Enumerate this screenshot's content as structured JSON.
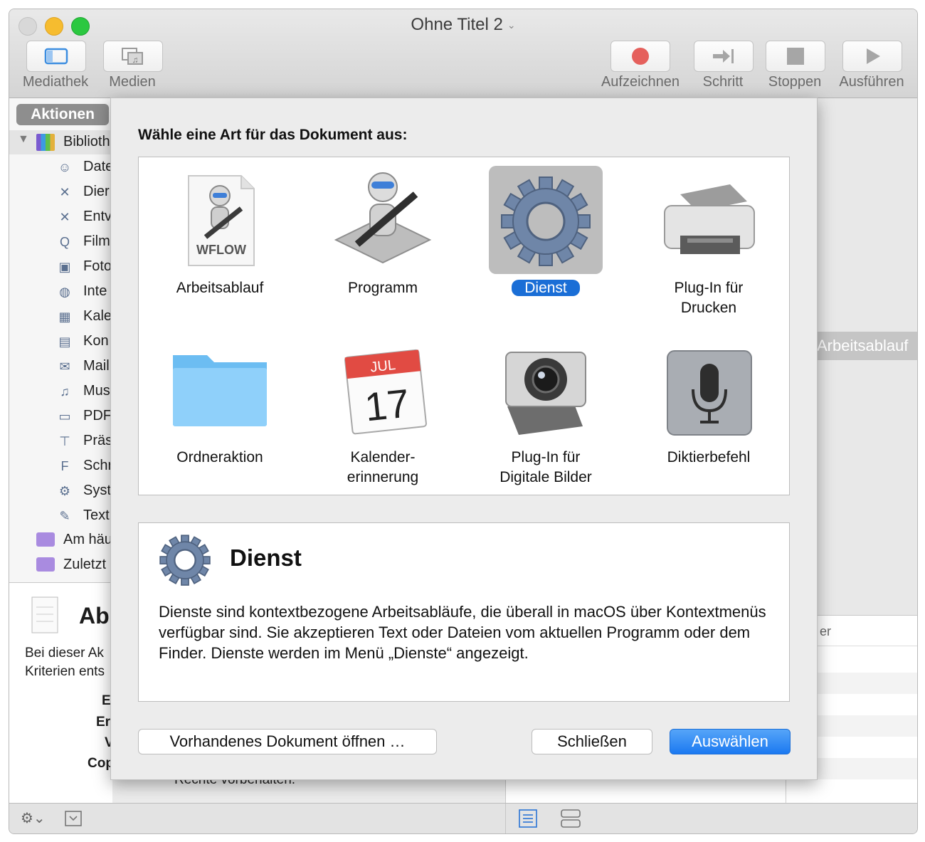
{
  "window": {
    "title": "Ohne Titel 2"
  },
  "toolbar": {
    "library_label": "Mediathek",
    "media_label": "Medien",
    "record_label": "Aufzeichnen",
    "step_label": "Schritt",
    "stop_label": "Stoppen",
    "run_label": "Ausführen"
  },
  "sidebar": {
    "tab_label": "Aktionen",
    "library_root": "Biblioth",
    "items": [
      {
        "label": "Date",
        "icon": "finder-icon"
      },
      {
        "label": "Dier",
        "icon": "tools-icon"
      },
      {
        "label": "Entv",
        "icon": "tools-icon"
      },
      {
        "label": "Film",
        "icon": "quicktime-icon"
      },
      {
        "label": "Foto",
        "icon": "photos-icon"
      },
      {
        "label": "Inte",
        "icon": "globe-icon"
      },
      {
        "label": "Kale",
        "icon": "calendar-icon"
      },
      {
        "label": "Kon",
        "icon": "contacts-icon"
      },
      {
        "label": "Mail",
        "icon": "mail-icon"
      },
      {
        "label": "Mus",
        "icon": "music-icon"
      },
      {
        "label": "PDF",
        "icon": "pdf-icon"
      },
      {
        "label": "Präs",
        "icon": "keynote-icon"
      },
      {
        "label": "Schr",
        "icon": "font-icon"
      },
      {
        "label": "Syst",
        "icon": "system-icon"
      },
      {
        "label": "Text",
        "icon": "text-icon"
      }
    ],
    "smart_groups": [
      {
        "label": "Am häu"
      },
      {
        "label": "Zuletzt"
      }
    ]
  },
  "info_panel": {
    "title": "Ab",
    "text_line1": "Bei dieser Ak",
    "text_line2": "Kriterien ents",
    "row1": "E",
    "row2": "Er",
    "row3": "V",
    "row4": "Cop",
    "footer": "Rechte vorbehalten."
  },
  "right_behind": {
    "workflow_label": "Arbeitsablauf",
    "column_header": "er"
  },
  "dialog": {
    "prompt": "Wähle eine Art für das Dokument aus:",
    "types": [
      {
        "label": "Arbeitsablauf",
        "icon": "workflow-file-icon",
        "doc_tag": "WFLOW"
      },
      {
        "label": "Programm",
        "icon": "automator-robot-icon"
      },
      {
        "label": "Dienst",
        "icon": "gear-icon",
        "selected": true
      },
      {
        "label": "Plug-In für\nDrucken",
        "line1": "Plug-In für",
        "line2": "Drucken",
        "icon": "printer-icon"
      },
      {
        "label": "Ordneraktion",
        "icon": "folder-icon"
      },
      {
        "label": "Kalender-\nerinnerung",
        "line1": "Kalender-",
        "line2": "erinnerung",
        "icon": "calendar-icon",
        "month": "JUL",
        "day": "17"
      },
      {
        "label": "Plug-In für\nDigitale Bilder",
        "line1": "Plug-In für",
        "line2": "Digitale Bilder",
        "icon": "camera-icon"
      },
      {
        "label": "Diktierbefehl",
        "icon": "microphone-icon"
      }
    ],
    "description": {
      "title": "Dienst",
      "text": "Dienste sind kontextbezogene Arbeitsabläufe, die überall in macOS über Kontextmenüs verfügbar sind. Sie akzeptieren Text oder Dateien vom aktuellen Programm oder dem Finder. Dienste werden im Menü „Dienste“ angezeigt."
    },
    "open_existing_label": "Vorhandenes Dokument öffnen …",
    "close_label": "Schließen",
    "choose_label": "Auswählen"
  },
  "colors": {
    "accent": "#1a6ed6",
    "record_red": "#e5605c",
    "selection_bg": "#bdbdbd"
  }
}
